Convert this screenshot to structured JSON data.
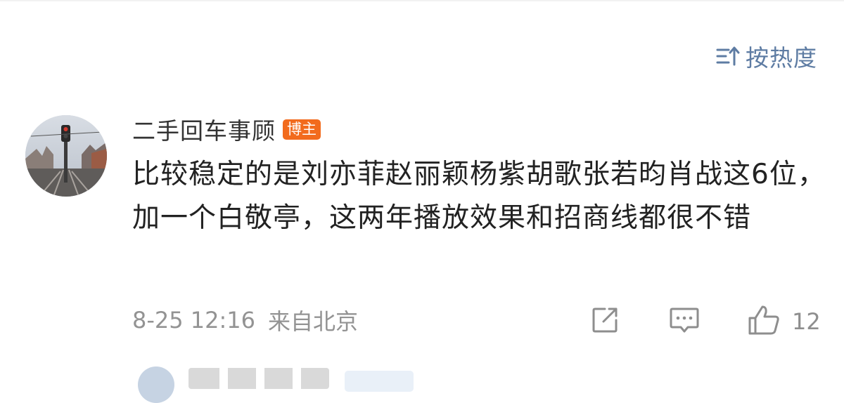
{
  "sort": {
    "label": "按热度",
    "icon": "sort-icon"
  },
  "comment": {
    "author": "二手回车事顾",
    "badge": "博主",
    "text": "比较稳定的是刘亦菲赵丽颖杨紫胡歌张若昀肖战这6位，加一个白敬亭，这两年播放效果和招商线都很不错",
    "time": "8-25 12:16",
    "location": "来自北京",
    "like_count": "12"
  },
  "colors": {
    "badge_bg": "#f26b1d",
    "sort_text": "#5e7ca3",
    "meta_text": "#939393"
  }
}
